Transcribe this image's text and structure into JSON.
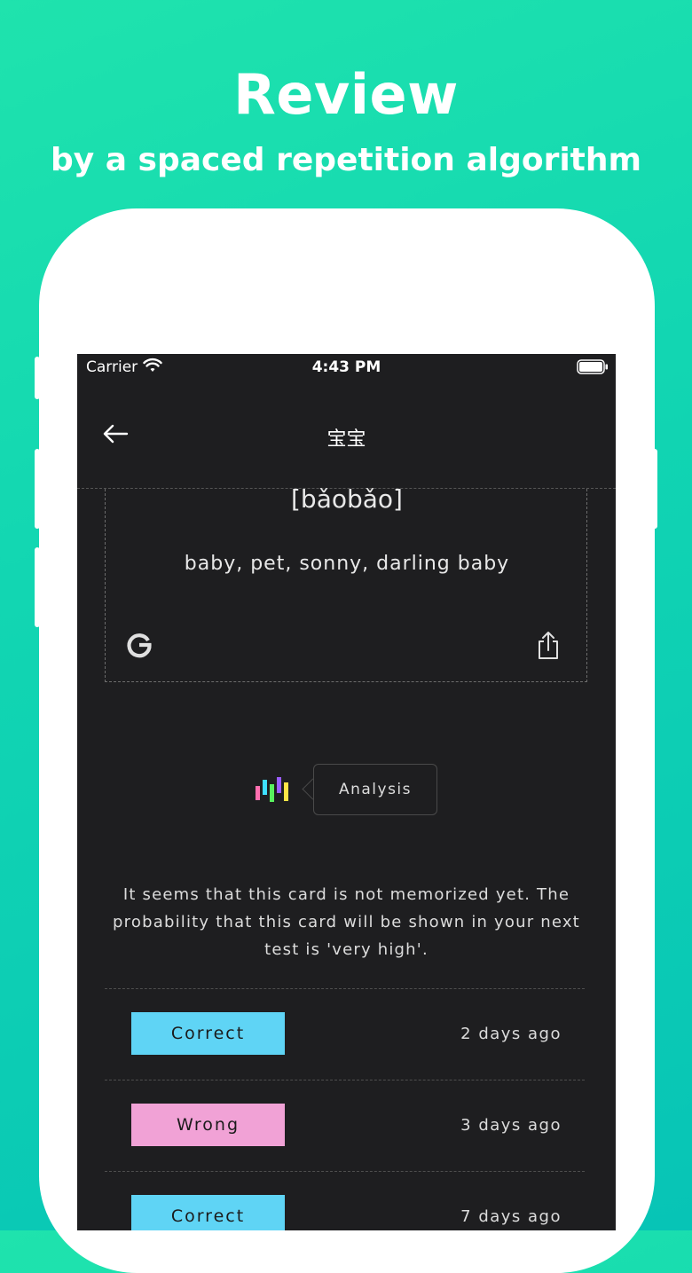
{
  "promo": {
    "headline": "Review",
    "subheadline": "by a spaced repetition algorithm"
  },
  "status_bar": {
    "carrier": "Carrier",
    "time": "4:43 PM"
  },
  "nav": {
    "title": "宝宝"
  },
  "card": {
    "pinyin": "[bǎobǎo]",
    "meaning": "baby, pet, sonny, darling baby"
  },
  "analysis": {
    "button_label": "Analysis",
    "message": "It seems that this card is not memorized yet. The probability that this card will be shown in your next test is 'very high'."
  },
  "history": [
    {
      "result": "Correct",
      "time": "2 days ago"
    },
    {
      "result": "Wrong",
      "time": "3 days ago"
    },
    {
      "result": "Correct",
      "time": "7 days ago"
    }
  ],
  "colors": {
    "correct": "#5fd4f5",
    "wrong": "#f1a2d6",
    "background_gradient_start": "#1fe3ad",
    "background_gradient_end": "#07c4b6",
    "screen_bg": "#1e1e20"
  }
}
